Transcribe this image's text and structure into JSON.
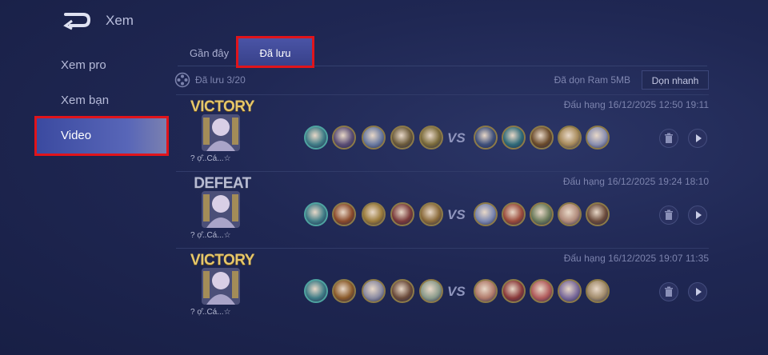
{
  "header": {
    "title": "Xem"
  },
  "sidebar": {
    "items": [
      {
        "label": "Xem pro"
      },
      {
        "label": "Xem bạn"
      },
      {
        "label": "Video"
      }
    ]
  },
  "tabs": [
    {
      "label": "Gần đây"
    },
    {
      "label": "Đã lưu"
    }
  ],
  "saved": {
    "count": "Đã lưu 3/20",
    "ram": "Đã dọn Ram 5MB",
    "clean_button": "Dọn nhanh"
  },
  "matches": [
    {
      "result": "VICTORY",
      "player": "? ợ̂..Cá...☆",
      "info": "Đấu hạng 16/12/2025 12:50 19:11"
    },
    {
      "result": "DEFEAT",
      "player": "? ợ̂..Cá...☆",
      "info": "Đấu hạng 16/12/2025 19:24 18:10"
    },
    {
      "result": "VICTORY",
      "player": "? ợ̂..Cá...☆",
      "info": "Đấu hạng 16/12/2025 19:07 11:35"
    }
  ],
  "vs_label": "VS",
  "icons": {
    "back": "back-arrow-icon",
    "reel": "film-reel-icon",
    "trash": "trash-icon",
    "play": "play-icon"
  }
}
